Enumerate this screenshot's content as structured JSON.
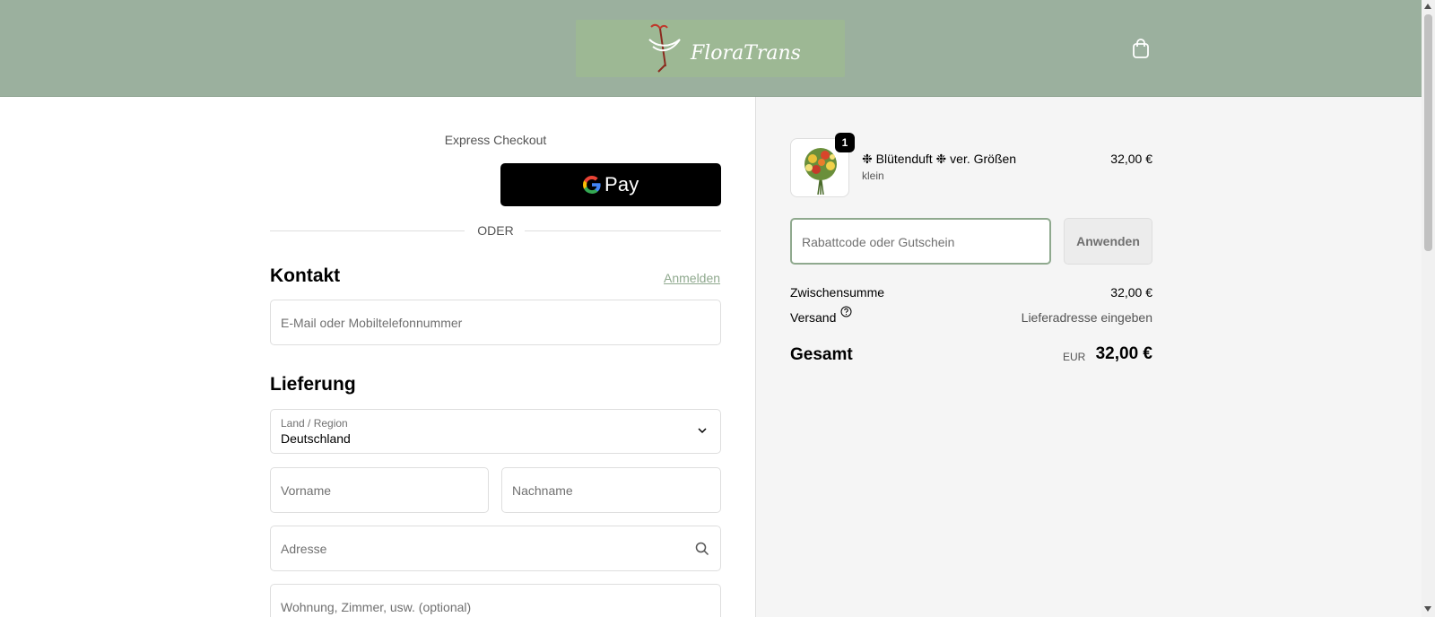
{
  "header": {
    "logo_text": "FloraTrans",
    "cart_icon": "shopping-bag-icon"
  },
  "express": {
    "title": "Express Checkout",
    "gpay_label": "Pay",
    "divider": "ODER"
  },
  "contact": {
    "heading": "Kontakt",
    "login": "Anmelden",
    "email_placeholder": "E-Mail oder Mobiltelefonnummer"
  },
  "delivery": {
    "heading": "Lieferung",
    "country_label": "Land / Region",
    "country_value": "Deutschland",
    "first_name_placeholder": "Vorname",
    "last_name_placeholder": "Nachname",
    "address_placeholder": "Adresse",
    "apartment_placeholder": "Wohnung, Zimmer, usw. (optional)"
  },
  "summary": {
    "product": {
      "name": "❉ Blütenduft ❉ ver. Größen",
      "variant": "klein",
      "price": "32,00 €",
      "quantity": "1"
    },
    "discount_placeholder": "Rabattcode oder Gutschein",
    "apply_label": "Anwenden",
    "subtotal_label": "Zwischensumme",
    "subtotal_value": "32,00 €",
    "shipping_label": "Versand",
    "shipping_value": "Lieferadresse eingeben",
    "total_label": "Gesamt",
    "total_currency": "EUR",
    "total_value": "32,00 €"
  },
  "colors": {
    "header_bg": "#9bb09e",
    "accent": "#8fa98e",
    "summary_bg": "#f5f5f5"
  }
}
